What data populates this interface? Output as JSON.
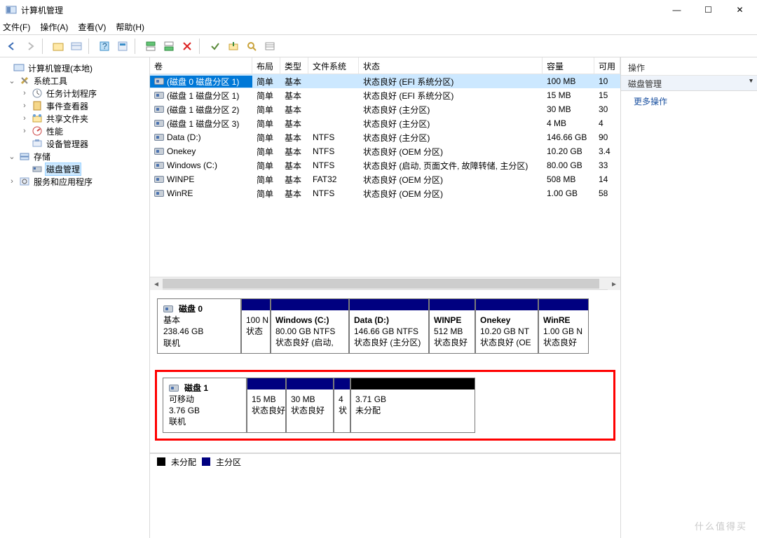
{
  "window": {
    "title": "计算机管理",
    "menu": {
      "file": "文件(F)",
      "action": "操作(A)",
      "view": "查看(V)",
      "help": "帮助(H)"
    },
    "controls": {
      "min": "—",
      "max": "☐",
      "close": "✕"
    }
  },
  "tree": {
    "root": "计算机管理(本地)",
    "systools": "系统工具",
    "scheduler": "任务计划程序",
    "eventviewer": "事件查看器",
    "shared": "共享文件夹",
    "perf": "性能",
    "devmgr": "设备管理器",
    "storage": "存储",
    "diskmgmt": "磁盘管理",
    "services": "服务和应用程序"
  },
  "vol_headers": {
    "volume": "卷",
    "layout": "布局",
    "type": "类型",
    "fs": "文件系统",
    "status": "状态",
    "capacity": "容量",
    "free": "可用"
  },
  "volumes": [
    {
      "name": "(磁盘 0 磁盘分区 1)",
      "layout": "简单",
      "type": "基本",
      "fs": "",
      "status": "状态良好 (EFI 系统分区)",
      "capacity": "100 MB",
      "free": "10",
      "selected": true
    },
    {
      "name": "(磁盘 1 磁盘分区 1)",
      "layout": "简单",
      "type": "基本",
      "fs": "",
      "status": "状态良好 (EFI 系统分区)",
      "capacity": "15 MB",
      "free": "15",
      "selected": false
    },
    {
      "name": "(磁盘 1 磁盘分区 2)",
      "layout": "简单",
      "type": "基本",
      "fs": "",
      "status": "状态良好 (主分区)",
      "capacity": "30 MB",
      "free": "30",
      "selected": false
    },
    {
      "name": "(磁盘 1 磁盘分区 3)",
      "layout": "简单",
      "type": "基本",
      "fs": "",
      "status": "状态良好 (主分区)",
      "capacity": "4 MB",
      "free": "4",
      "selected": false
    },
    {
      "name": "Data (D:)",
      "layout": "简单",
      "type": "基本",
      "fs": "NTFS",
      "status": "状态良好 (主分区)",
      "capacity": "146.66 GB",
      "free": "90",
      "selected": false
    },
    {
      "name": "Onekey",
      "layout": "简单",
      "type": "基本",
      "fs": "NTFS",
      "status": "状态良好 (OEM 分区)",
      "capacity": "10.20 GB",
      "free": "3.4",
      "selected": false
    },
    {
      "name": "Windows (C:)",
      "layout": "简单",
      "type": "基本",
      "fs": "NTFS",
      "status": "状态良好 (启动, 页面文件, 故障转储, 主分区)",
      "capacity": "80.00 GB",
      "free": "33",
      "selected": false
    },
    {
      "name": "WINPE",
      "layout": "简单",
      "type": "基本",
      "fs": "FAT32",
      "status": "状态良好 (OEM 分区)",
      "capacity": "508 MB",
      "free": "14",
      "selected": false
    },
    {
      "name": "WinRE",
      "layout": "简单",
      "type": "基本",
      "fs": "NTFS",
      "status": "状态良好 (OEM 分区)",
      "capacity": "1.00 GB",
      "free": "58",
      "selected": false
    }
  ],
  "disks": [
    {
      "title": "磁盘 0",
      "type": "基本",
      "size": "238.46 GB",
      "status": "联机",
      "parts": [
        {
          "name": "",
          "size": "100 N",
          "status": "状态",
          "w": 42,
          "kind": "primary"
        },
        {
          "name": "Windows  (C:)",
          "size": "80.00 GB NTFS",
          "status": "状态良好 (启动,",
          "w": 112,
          "kind": "primary"
        },
        {
          "name": "Data  (D:)",
          "size": "146.66 GB NTFS",
          "status": "状态良好 (主分区)",
          "w": 114,
          "kind": "primary"
        },
        {
          "name": "WINPE",
          "size": "512 MB",
          "status": "状态良好",
          "w": 66,
          "kind": "primary"
        },
        {
          "name": "Onekey",
          "size": "10.20 GB NT",
          "status": "状态良好 (OE",
          "w": 90,
          "kind": "primary"
        },
        {
          "name": "WinRE",
          "size": "1.00 GB N",
          "status": "状态良好",
          "w": 72,
          "kind": "primary"
        }
      ]
    },
    {
      "title": "磁盘 1",
      "type": "可移动",
      "size": "3.76 GB",
      "status": "联机",
      "parts": [
        {
          "name": "",
          "size": "15 MB",
          "status": "状态良好",
          "w": 56,
          "kind": "primary"
        },
        {
          "name": "",
          "size": "30 MB",
          "status": "状态良好",
          "w": 68,
          "kind": "primary"
        },
        {
          "name": "",
          "size": "4",
          "status": "状",
          "w": 24,
          "kind": "primary"
        },
        {
          "name": "",
          "size": "3.71 GB",
          "status": "未分配",
          "w": 178,
          "kind": "unalloc"
        }
      ]
    }
  ],
  "legend": {
    "unalloc": "未分配",
    "primary": "主分区"
  },
  "actions": {
    "header": "操作",
    "tab": "磁盘管理",
    "more": "更多操作"
  },
  "watermark": "什么值得买"
}
